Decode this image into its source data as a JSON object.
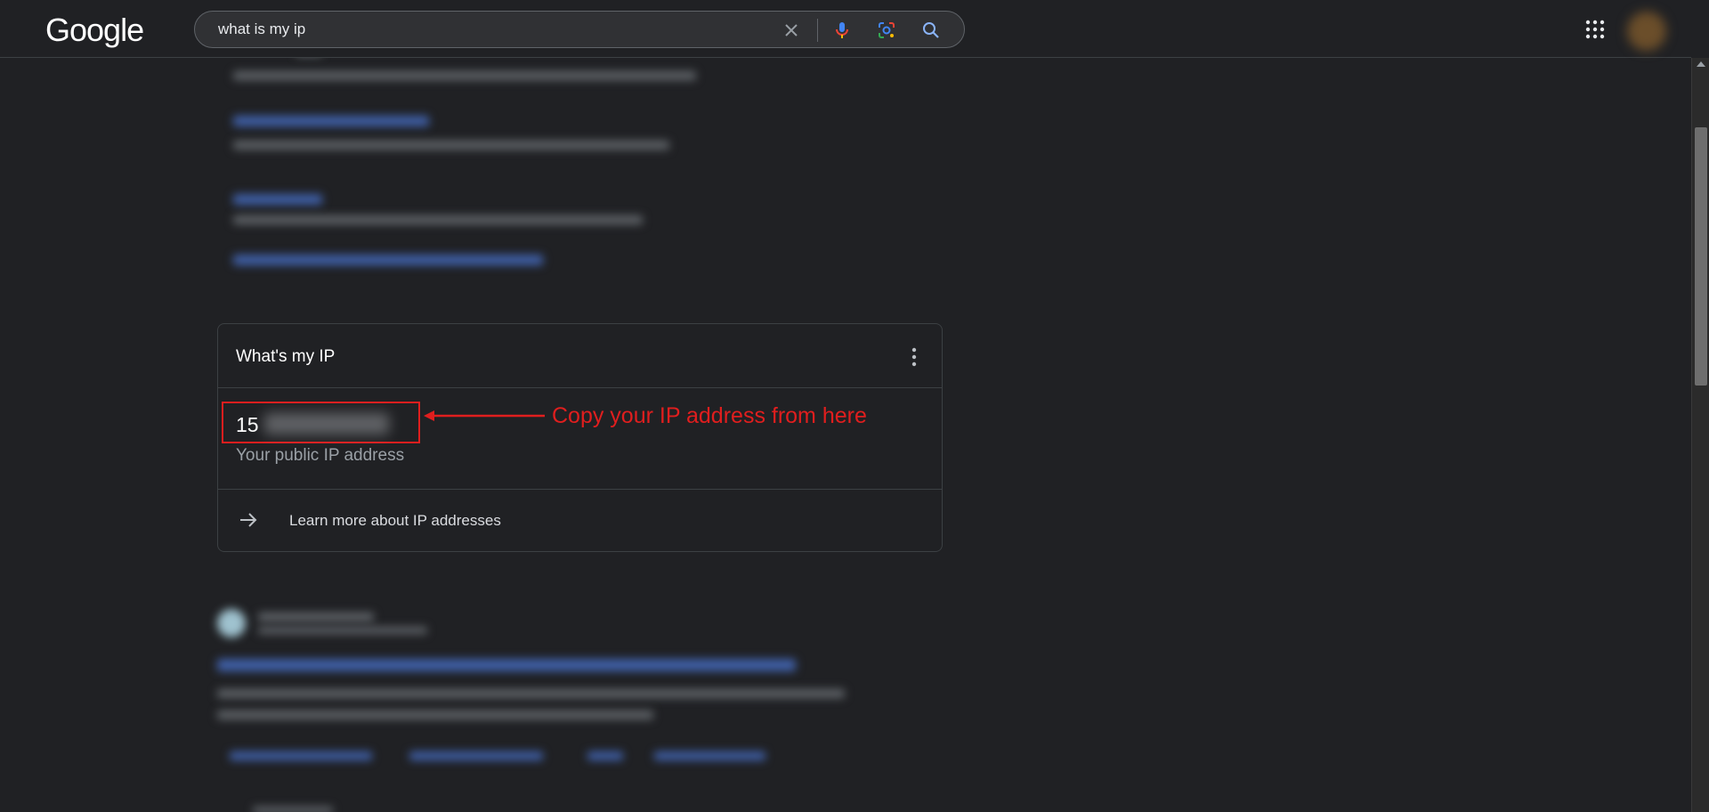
{
  "header": {
    "logo": "Google",
    "search": {
      "value": "what is my ip",
      "placeholder": ""
    },
    "icons": [
      "close-icon",
      "mic-icon",
      "lens-icon",
      "search-icon",
      "apps-icon",
      "avatar"
    ]
  },
  "ip_card": {
    "title": "What's my IP",
    "ip_value": "15",
    "ip_caption": "Your public IP address",
    "learn_more": "Learn more about IP addresses"
  },
  "annotation": {
    "text": "Copy your IP address from here",
    "color": "#e01e1e"
  },
  "colors": {
    "background": "#202124",
    "surface": "#303134",
    "border": "#3c4043",
    "text": "#e8eaed",
    "muted": "#9aa0a6",
    "annotation_red": "#e01e1e"
  }
}
